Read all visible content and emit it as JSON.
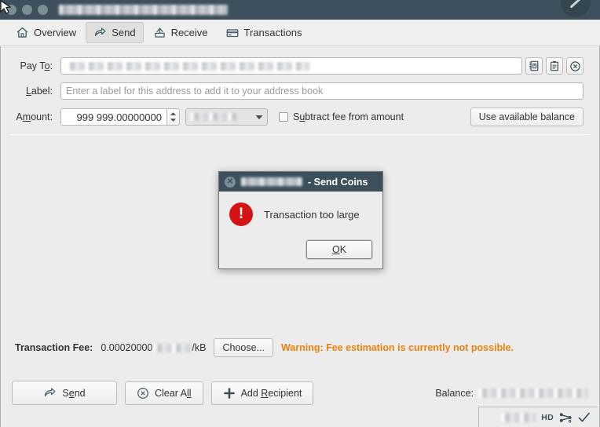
{
  "window": {
    "title_redacted": true,
    "controls": [
      "close",
      "minimize",
      "maximize"
    ],
    "titlebar_color": "#3c4f5b"
  },
  "toolbar": {
    "tabs": [
      {
        "label": "Overview",
        "icon": "home-icon",
        "active": false,
        "accel": ""
      },
      {
        "label": "Send",
        "icon": "send-arrow-icon",
        "active": true,
        "accel": "S"
      },
      {
        "label": "Receive",
        "icon": "receive-inbox-icon",
        "active": false,
        "accel": ""
      },
      {
        "label": "Transactions",
        "icon": "card-icon",
        "active": false,
        "accel": ""
      }
    ]
  },
  "form": {
    "payto": {
      "label_pre": "Pay T",
      "label_accel": "o",
      "label_post": ":",
      "value_redacted": true,
      "buttons": [
        {
          "name": "address-book-button",
          "icon": "address-book-icon"
        },
        {
          "name": "paste-button",
          "icon": "clipboard-icon"
        },
        {
          "name": "clear-address-button",
          "icon": "circle-x-icon"
        }
      ]
    },
    "label": {
      "label_pre": "",
      "label_accel": "L",
      "label_post": "abel:",
      "placeholder": "Enter a label for this address to add it to your address book",
      "value": ""
    },
    "amount": {
      "label_pre": "A",
      "label_accel": "m",
      "label_post": "ount:",
      "value": "999 999.00000000",
      "unit_redacted": true,
      "subtract_fee": {
        "pre": "S",
        "accel": "u",
        "post": "btract fee from amount",
        "checked": false
      },
      "use_balance_button": "Use available balance"
    }
  },
  "fee": {
    "label": "Transaction Fee:",
    "amount": "0.00020000",
    "unit_redacted": true,
    "per": "/kB",
    "choose_button": "Choose...",
    "warning": "Warning: Fee estimation is currently not possible.",
    "warning_color": "#e8820c"
  },
  "actions": {
    "send": {
      "pre": "S",
      "accel": "e",
      "post": "nd",
      "icon": "send-arrow-icon"
    },
    "clear_all": {
      "pre": "Clear A",
      "accel": "ll",
      "post": "",
      "icon": "circle-x-icon"
    },
    "add_recipient": {
      "pre": "Add ",
      "accel": "R",
      "post": "ecipient",
      "icon": "plus-icon"
    },
    "balance_label": "Balance:",
    "balance_redacted": true
  },
  "statusbar": {
    "text_redacted": true,
    "hd_label": "HD",
    "icons": [
      "network-icon",
      "check-icon"
    ]
  },
  "dialog": {
    "title_redacted": true,
    "title_suffix": "- Send Coins",
    "icon": "error-icon",
    "message": "Transaction too large",
    "ok_button": {
      "pre": "",
      "accel": "O",
      "post": "K"
    }
  }
}
